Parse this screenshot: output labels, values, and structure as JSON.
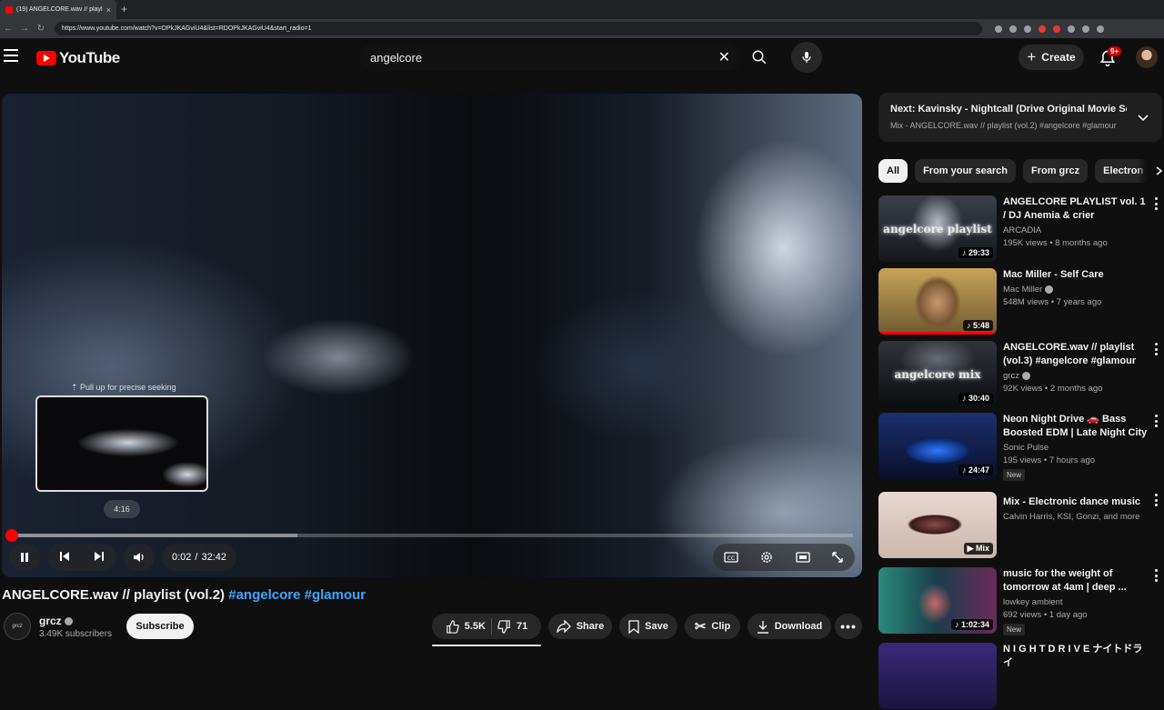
{
  "browser": {
    "tab_title": "(19) ANGELCORE.wav // playlis",
    "url": "https://www.youtube.com/watch?v=OPkJKAGviU4&list=RDOPkJKAGviU4&start_radio=1"
  },
  "header": {
    "logo_text": "YouTube",
    "search_value": "angelcore",
    "create_label": "Create",
    "notification_badge": "9+"
  },
  "player": {
    "seek_hint": "Pull up for precise seeking",
    "preview_time": "4:16",
    "current_time": "0:02",
    "duration": "32:42",
    "time_separator": "/",
    "played_fraction": 0.001,
    "buffered_fraction": 0.34
  },
  "video": {
    "title": "ANGELCORE.wav // playlist (vol.2)",
    "hashtags": [
      "#angelcore",
      "#glamour"
    ],
    "channel": {
      "name": "grcz",
      "subscribers": "3.49K subscribers",
      "avatar_text": "grcz"
    },
    "subscribe_label": "Subscribe",
    "actions": {
      "likes": "5.5K",
      "dislikes": "71",
      "share": "Share",
      "save": "Save",
      "clip": "Clip",
      "download": "Download"
    }
  },
  "next_up": {
    "title": "Next: Kavinsky - Nightcall (Drive Original Movie Sou...",
    "subtitle": "Mix - ANGELCORE.wav // playlist (vol.2) #angelcore #glamour"
  },
  "chips": [
    "All",
    "From your search",
    "From grcz",
    "Electron"
  ],
  "recommendations": [
    {
      "title": "ANGELCORE PLAYLIST vol. 1 / DJ Anemia & crier",
      "channel": "ARCADIA",
      "verified": false,
      "meta": "195K views • 8 months ago",
      "duration": "29:33",
      "thumb_text": "angelcore playlist",
      "badge": ""
    },
    {
      "title": "Mac Miller - Self Care",
      "channel": "Mac Miller",
      "verified": true,
      "meta": "548M views • 7 years ago",
      "duration": "5:48",
      "thumb_text": "",
      "badge": ""
    },
    {
      "title": "ANGELCORE.wav // playlist (vol.3) #angelcore #glamour",
      "channel": "grcz",
      "verified": true,
      "meta": "92K views • 2 months ago",
      "duration": "30:40",
      "thumb_text": "angelcore mix",
      "badge": ""
    },
    {
      "title": "Neon Night Drive 🚗 Bass Boosted EDM | Late Night City ...",
      "channel": "Sonic Pulse",
      "verified": false,
      "meta": "195 views • 7 hours ago",
      "duration": "24:47",
      "thumb_text": "",
      "badge": "New"
    },
    {
      "title": "Mix - Electronic dance music",
      "channel": "Calvin Harris, KSI, Gonzi, and more",
      "verified": false,
      "meta": "",
      "duration": "Mix",
      "thumb_text": "",
      "badge": ""
    },
    {
      "title": "music for the weight of tomorrow at 4am | deep ...",
      "channel": "lowkey ambient",
      "verified": false,
      "meta": "692 views • 1 day ago",
      "duration": "1:02:34",
      "thumb_text": "",
      "badge": "New"
    },
    {
      "title": "N I G H T D R I V E ナイトドライ",
      "channel": "",
      "verified": false,
      "meta": "",
      "duration": "",
      "thumb_text": "",
      "badge": ""
    }
  ],
  "colors": {
    "background": "#0f0f0f",
    "accent_red": "#ff0000",
    "hashtag_blue": "#3ea6ff",
    "chip_bg": "#272727"
  }
}
